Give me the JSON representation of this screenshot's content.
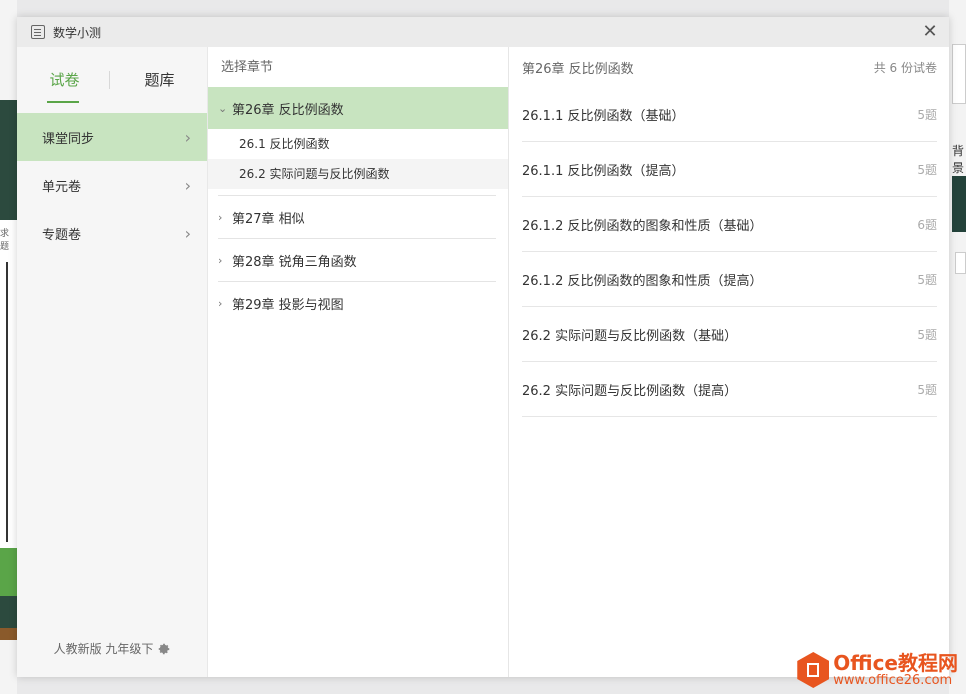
{
  "window": {
    "title": "数学小测",
    "close_glyph": "✕"
  },
  "tabs": [
    {
      "label": "试卷",
      "active": true
    },
    {
      "label": "题库",
      "active": false
    }
  ],
  "nav": [
    {
      "label": "课堂同步",
      "active": true
    },
    {
      "label": "单元卷",
      "active": false
    },
    {
      "label": "专题卷",
      "active": false
    }
  ],
  "footer": {
    "label": "人教新版 九年级下"
  },
  "chapters": {
    "header": "选择章节",
    "items": [
      {
        "label": "第26章 反比例函数",
        "expanded": true,
        "subs": [
          {
            "label": "26.1 反比例函数"
          },
          {
            "label": "26.2 实际问题与反比例函数"
          }
        ]
      },
      {
        "label": "第27章 相似",
        "expanded": false
      },
      {
        "label": "第28章 锐角三角函数",
        "expanded": false
      },
      {
        "label": "第29章 投影与视图",
        "expanded": false
      }
    ]
  },
  "papers": {
    "header_title": "第26章 反比例函数",
    "header_count": "共 6 份试卷",
    "items": [
      {
        "title": "26.1.1 反比例函数（基础）",
        "count": "5题"
      },
      {
        "title": "26.1.1 反比例函数（提高）",
        "count": "5题"
      },
      {
        "title": "26.1.2 反比例函数的图象和性质（基础）",
        "count": "6题"
      },
      {
        "title": "26.1.2 反比例函数的图象和性质（提高）",
        "count": "5题"
      },
      {
        "title": "26.2 实际问题与反比例函数（基础）",
        "count": "5题"
      },
      {
        "title": "26.2 实际问题与反比例函数（提高）",
        "count": "5题"
      }
    ]
  },
  "background": {
    "left_tag": "求题",
    "right_text": "背景"
  },
  "watermark": {
    "line1": "Office教程网",
    "line2": "www.office26.com"
  },
  "colors": {
    "accent": "#5aa548",
    "selected_bg": "#c8e4c0",
    "watermark": "#e8551f"
  },
  "icons": {
    "title": "document-icon",
    "close": "close-icon",
    "chevron": "chevron-right-icon",
    "expand": "chevron-down-icon",
    "settings": "gear-icon"
  }
}
